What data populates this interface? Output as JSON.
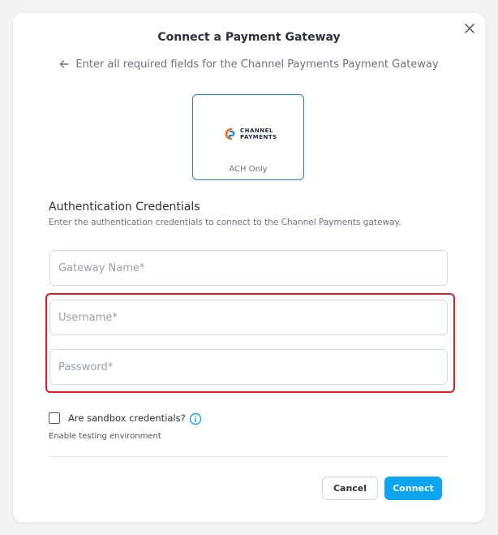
{
  "modal": {
    "title": "Connect a Payment Gateway",
    "subtitle": "Enter all required fields for the Channel Payments Payment Gateway"
  },
  "gateway_card": {
    "logo_line1": "CHANNEL",
    "logo_line2": "PAYMENTS",
    "tag": "ACH Only"
  },
  "auth": {
    "section_title": "Authentication Credentials",
    "section_desc": "Enter the authentication credentials to connect to the Channel Payments gateway."
  },
  "fields": {
    "gateway_name": {
      "value": "",
      "placeholder": "Gateway Name*"
    },
    "username": {
      "value": "",
      "placeholder": "Username*"
    },
    "password": {
      "value": "",
      "placeholder": "Password*"
    }
  },
  "sandbox": {
    "label": "Are sandbox credentials?",
    "hint": "Enable testing environment",
    "checked": false
  },
  "buttons": {
    "cancel": "Cancel",
    "connect": "Connect"
  },
  "colors": {
    "accent": "#0ea5f0",
    "card_border": "#2a7de1",
    "highlight": "#e31b23",
    "logo_orange": "#f26a21",
    "logo_blue": "#1e88e5"
  },
  "icons": {
    "close": "close-icon",
    "back": "arrow-left-icon",
    "info": "info-icon",
    "logo": "channel-payments-logo"
  }
}
